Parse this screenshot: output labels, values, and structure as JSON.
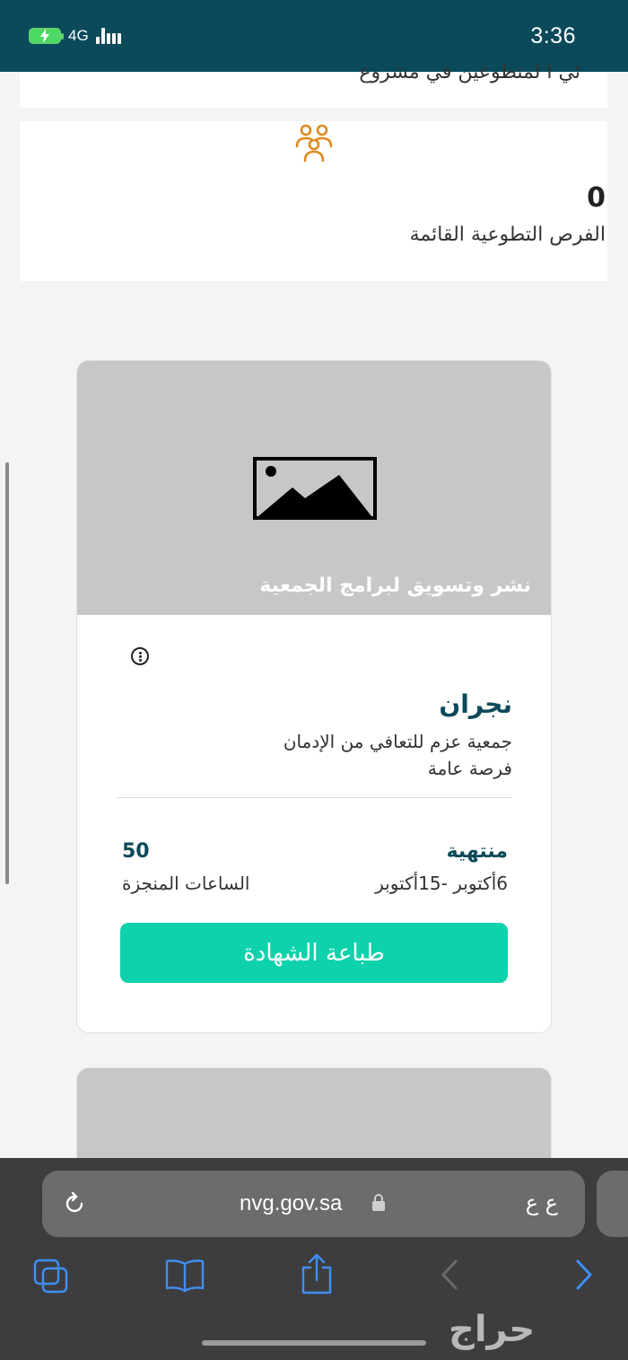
{
  "status_bar": {
    "time": "3:36",
    "network": "4G",
    "colors": {
      "background": "#0b4a5a",
      "battery": "#4cd964"
    }
  },
  "top_card": {
    "partial_text": "ئي ا لمتطوعين في مشروع"
  },
  "stats": {
    "icon": "people-icon",
    "value": "0",
    "label": "الفرص التطوعية القائمة",
    "icon_color": "#e08a1e"
  },
  "opportunity": {
    "image_icon": "image-placeholder-icon",
    "title": "نشر وتسويق لبرامج الجمعية",
    "city": "نجران",
    "organization": "جمعية عزم للتعافي من الإدمان",
    "type": "فرصة عامة",
    "status": "منتهية",
    "dates": "6أكتوبر -15أكتوبر",
    "hours_value": "50",
    "hours_label": "الساعات المنجزة",
    "print_button": "طباعة الشهادة",
    "colors": {
      "accent": "#0b4a5a",
      "button": "#0ed2ab",
      "image_bg": "#c7c7c7"
    }
  },
  "browser": {
    "url": "nvg.gov.sa",
    "text_size_label": "ع ع",
    "toolbar": [
      "tabs-icon",
      "bookmarks-icon",
      "share-icon",
      "back-icon",
      "forward-icon"
    ]
  },
  "watermark": "حراج"
}
